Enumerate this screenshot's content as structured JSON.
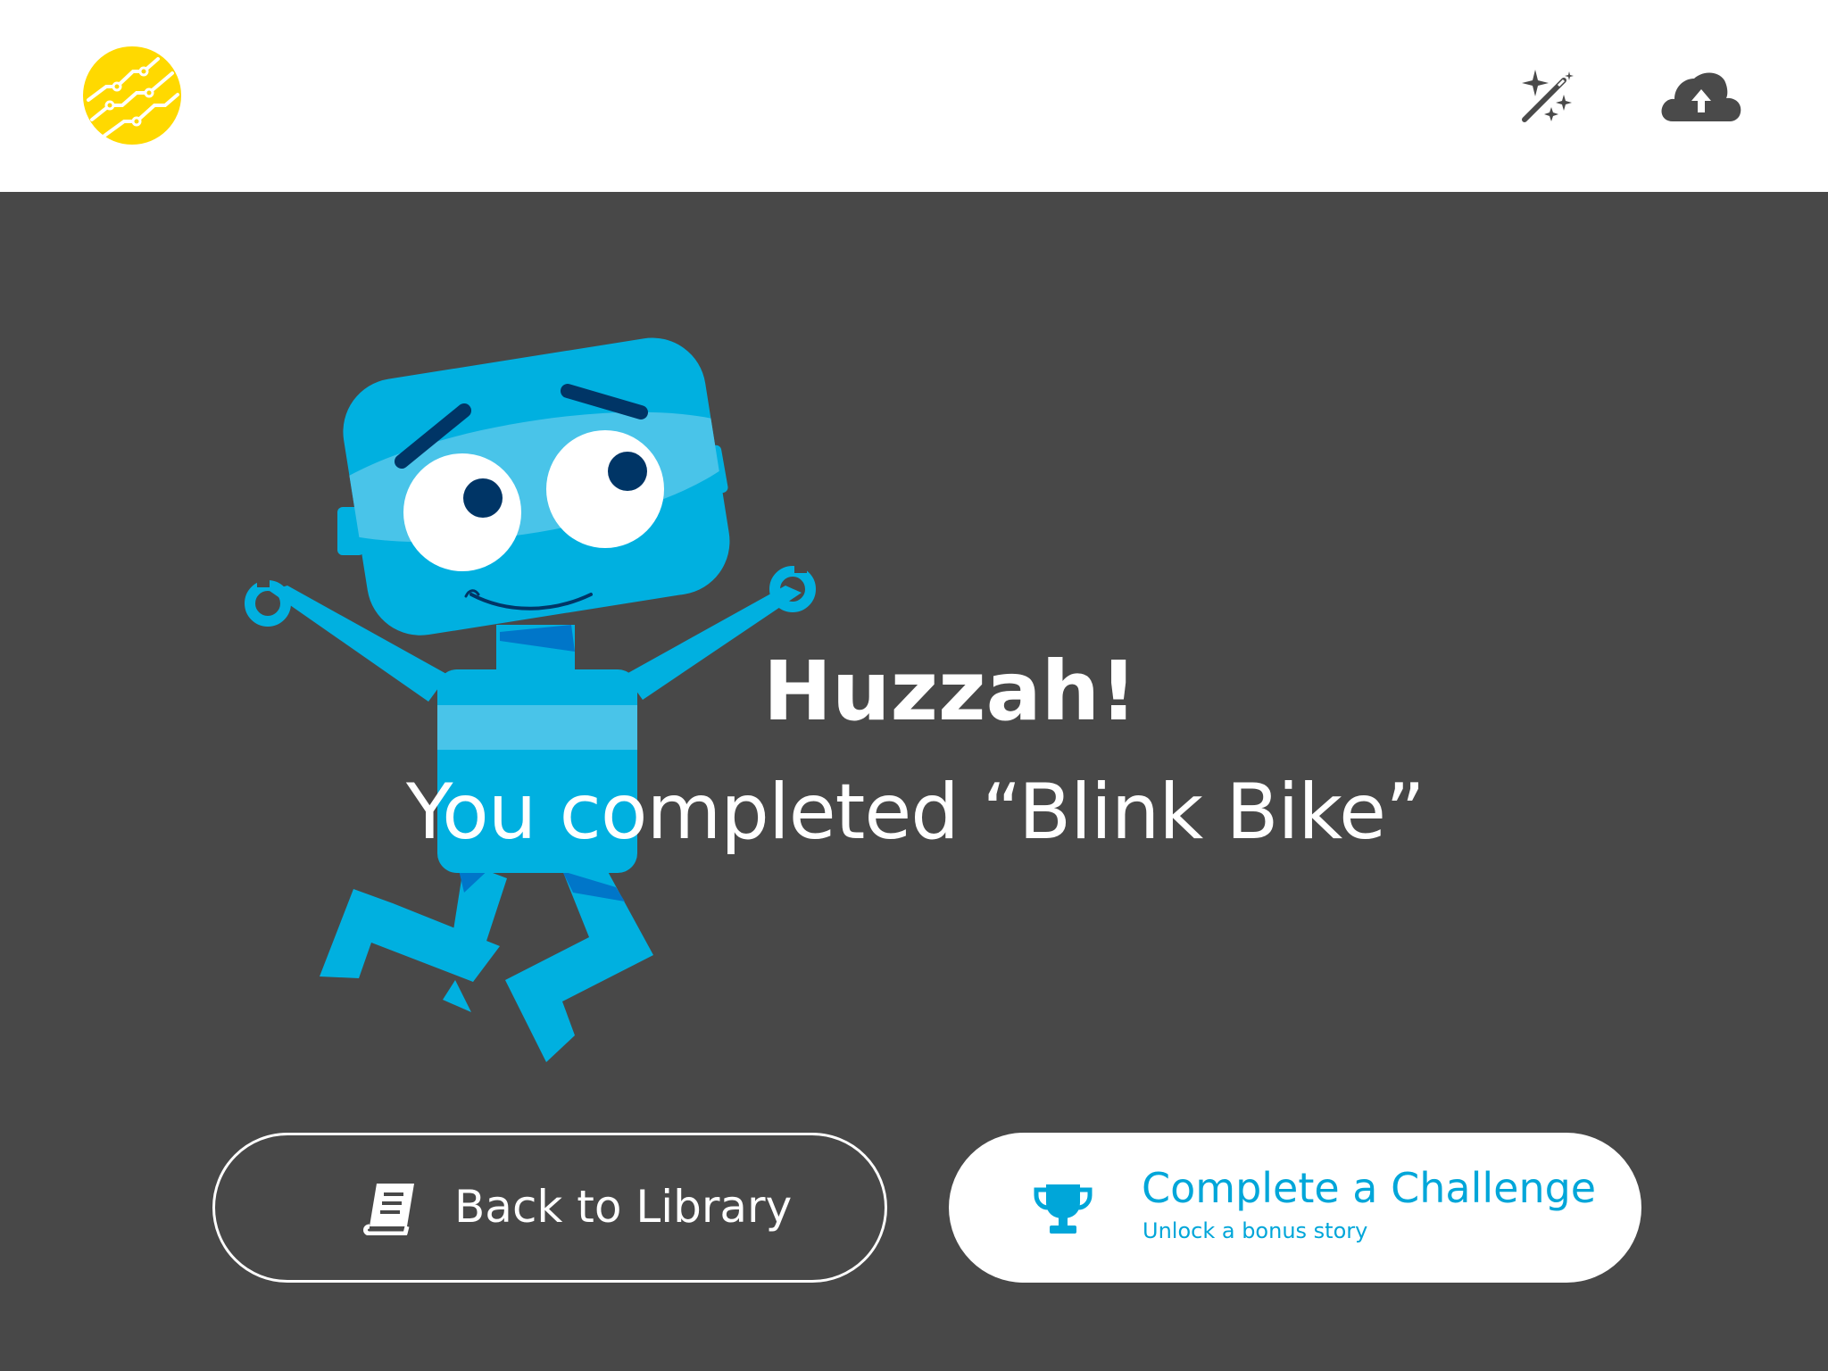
{
  "header": {
    "logo_icon": "circuit-logo-icon",
    "actions": [
      {
        "name": "magic-wand",
        "icon": "magic-wand-icon"
      },
      {
        "name": "cloud-upload",
        "icon": "cloud-upload-icon"
      }
    ]
  },
  "message": {
    "headline": "Huzzah!",
    "subline": "You completed “Blink Bike”"
  },
  "buttons": {
    "library": {
      "label": "Back to Library",
      "icon": "book-icon"
    },
    "challenge": {
      "label": "Complete a Challenge",
      "sublabel": "Unlock a bonus story",
      "icon": "trophy-icon"
    }
  },
  "colors": {
    "background": "#484848",
    "header": "#ffffff",
    "accent": "#00a6d9",
    "logo": "#ffd900",
    "robot_primary": "#00b0e0",
    "robot_light": "#49c4e9",
    "robot_dark": "#003566"
  }
}
